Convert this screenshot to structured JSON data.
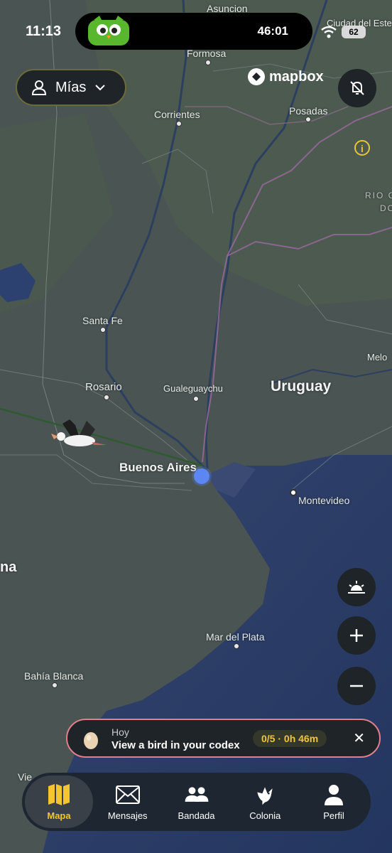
{
  "status_bar": {
    "time": "11:13",
    "timer": "46:01",
    "battery": "62"
  },
  "filter": {
    "label": "Mías"
  },
  "mapbox": {
    "brand": "mapbox"
  },
  "map": {
    "labels": {
      "asuncion": "Asuncion",
      "ciudad_del_este": "Ciudad del Este",
      "formosa": "Formosa",
      "corrientes": "Corrientes",
      "posadas": "Posadas",
      "rio_grande": "RIO G",
      "rio_grande_2": "DO",
      "santa_fe": "Santa Fe",
      "rosario": "Rosario",
      "gualeguaychu": "Gualeguaychu",
      "uruguay": "Uruguay",
      "melo": "Melo",
      "buenos_aires": "Buenos Aires",
      "montevideo": "Montevideo",
      "na": "na",
      "mar_del_plata": "Mar del Plata",
      "bahia_blanca": "Bahía Blanca",
      "vie": "Vie"
    }
  },
  "quest": {
    "title": "Hoy",
    "description": "View a bird in your codex",
    "progress": "0/5 · 0h 46m"
  },
  "tabs": [
    {
      "label": "Mapa",
      "icon": "map-icon",
      "active": true
    },
    {
      "label": "Mensajes",
      "icon": "envelope-icon",
      "active": false
    },
    {
      "label": "Bandada",
      "icon": "group-icon",
      "active": false
    },
    {
      "label": "Colonia",
      "icon": "bird-icon",
      "active": false
    },
    {
      "label": "Perfil",
      "icon": "person-icon",
      "active": false
    }
  ],
  "colors": {
    "accent": "#f2c531",
    "water": "#2c4170",
    "land": "#4a5553",
    "user_location": "#5c86f2",
    "quest_border": "#e27f8a"
  }
}
